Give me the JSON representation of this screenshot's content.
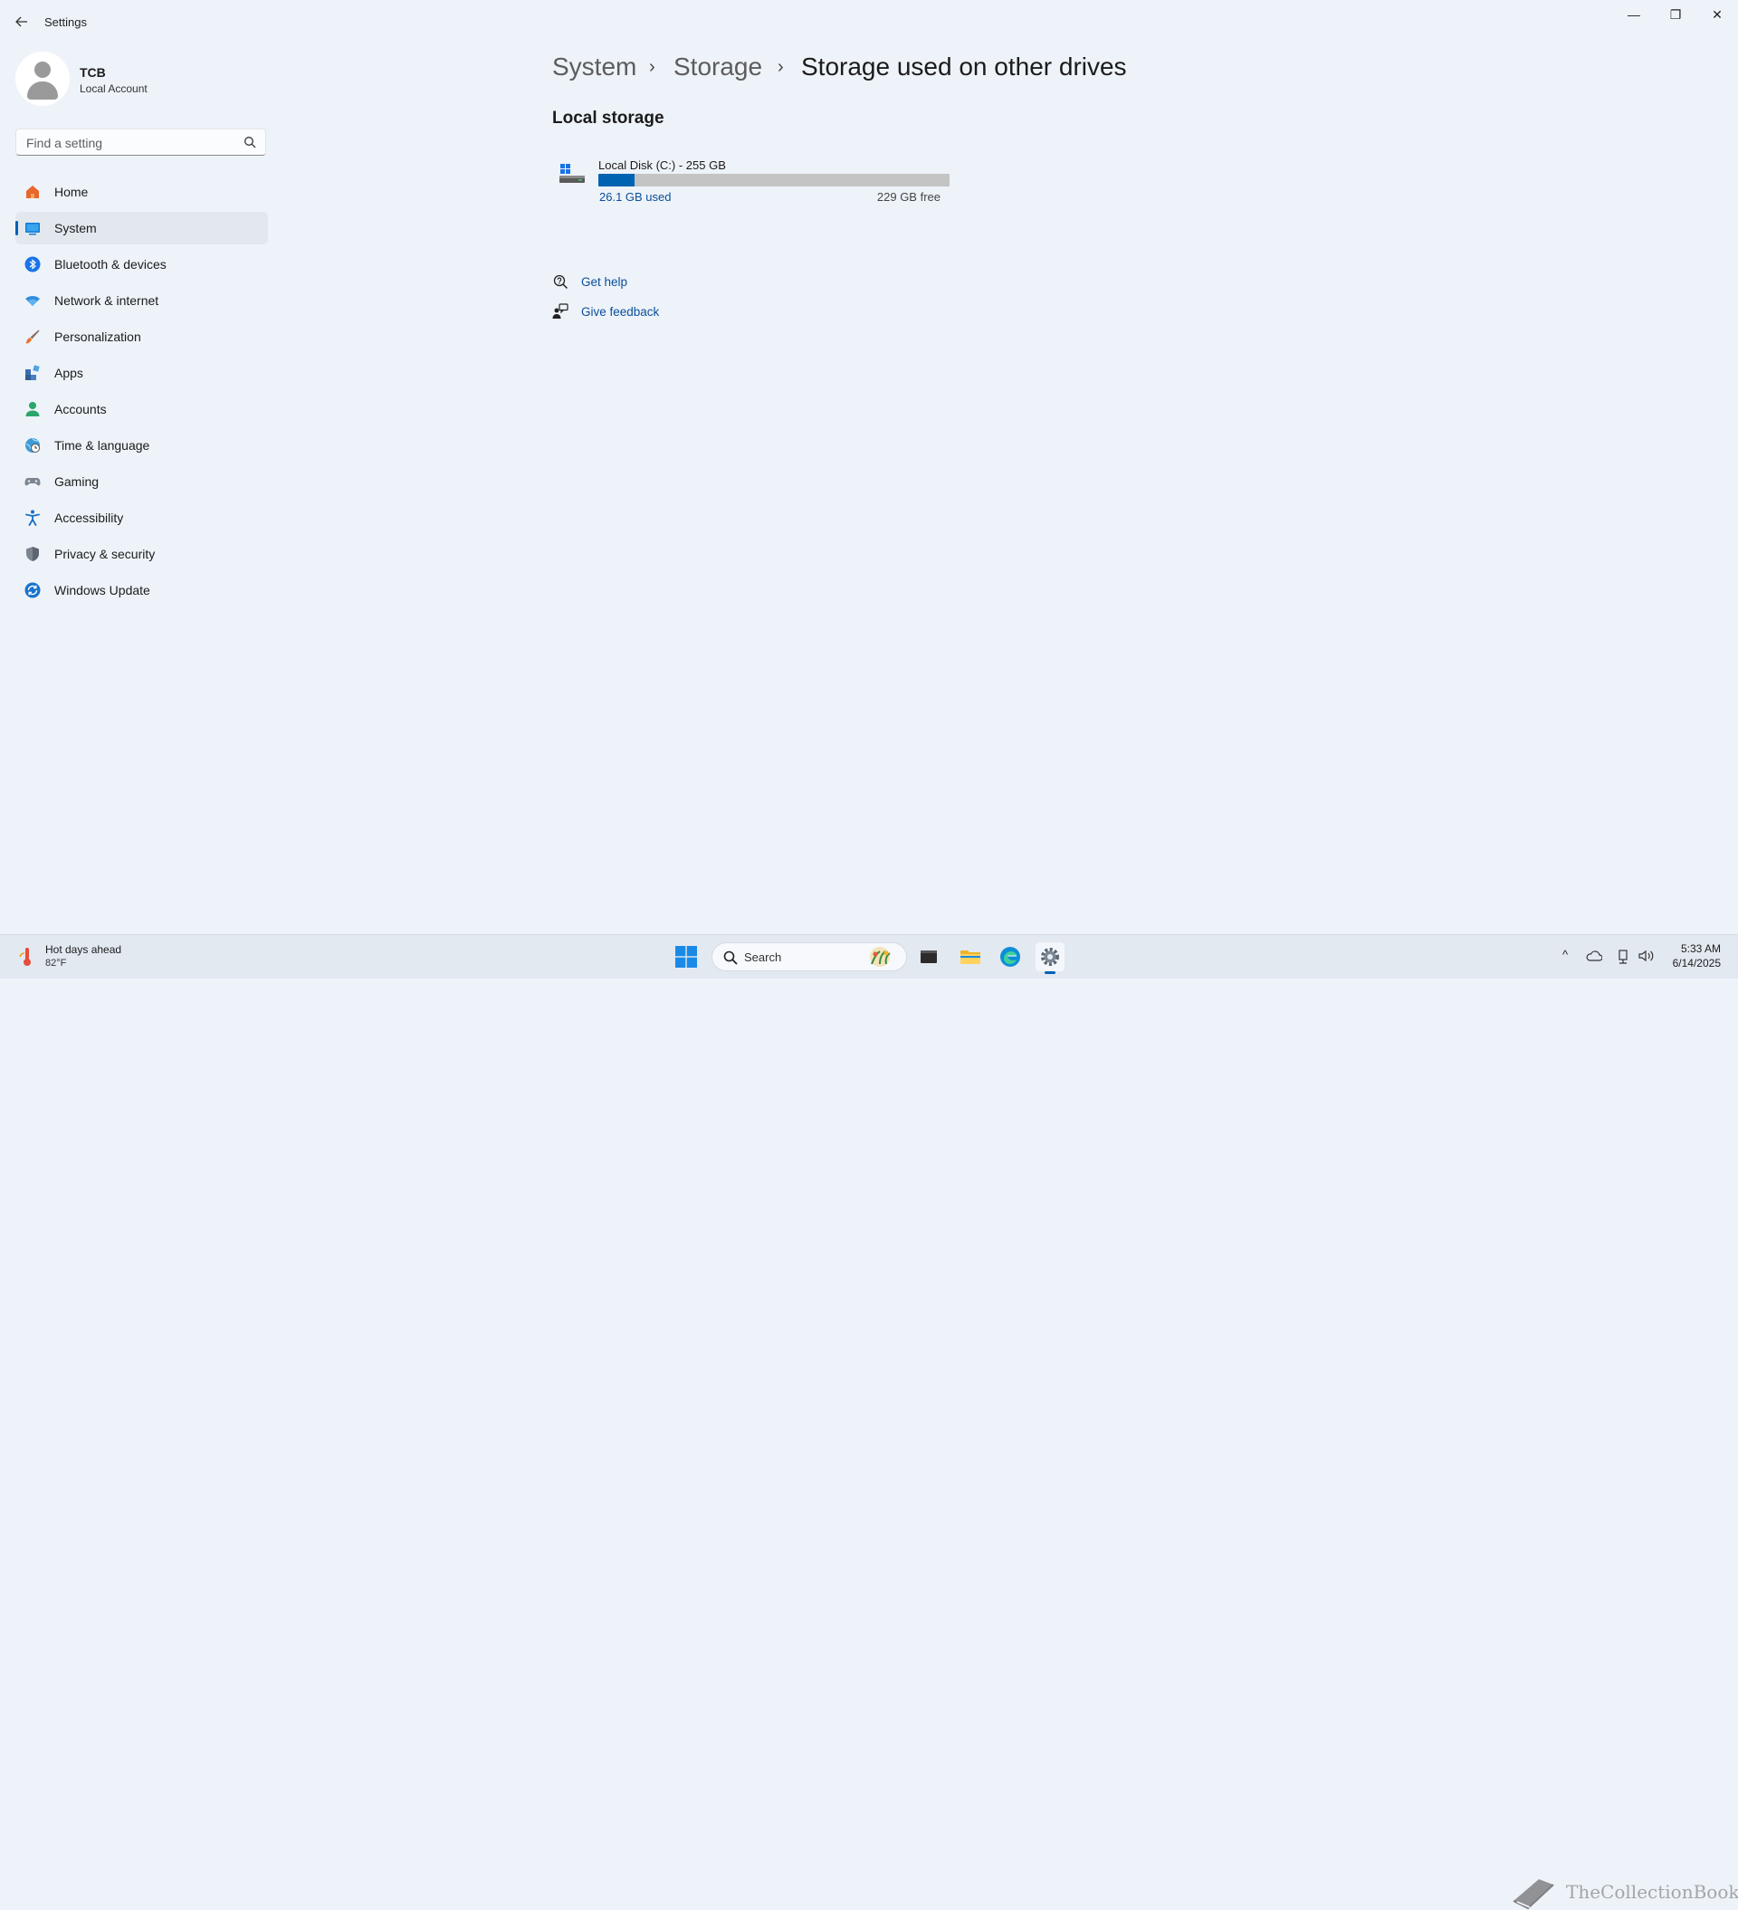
{
  "window": {
    "title": "Settings",
    "controls": {
      "minimize": "—",
      "maximize": "❐",
      "close": "✕"
    }
  },
  "profile": {
    "name": "TCB",
    "account_type": "Local Account"
  },
  "search": {
    "placeholder": "Find a setting"
  },
  "sidebar": {
    "items": [
      {
        "label": "Home",
        "icon": "home-icon"
      },
      {
        "label": "System",
        "icon": "system-icon",
        "active": true
      },
      {
        "label": "Bluetooth & devices",
        "icon": "bluetooth-icon"
      },
      {
        "label": "Network & internet",
        "icon": "wifi-icon"
      },
      {
        "label": "Personalization",
        "icon": "brush-icon"
      },
      {
        "label": "Apps",
        "icon": "apps-icon"
      },
      {
        "label": "Accounts",
        "icon": "accounts-icon"
      },
      {
        "label": "Time & language",
        "icon": "globe-clock-icon"
      },
      {
        "label": "Gaming",
        "icon": "gamepad-icon"
      },
      {
        "label": "Accessibility",
        "icon": "accessibility-icon"
      },
      {
        "label": "Privacy & security",
        "icon": "shield-icon"
      },
      {
        "label": "Windows Update",
        "icon": "update-icon"
      }
    ]
  },
  "breadcrumb": {
    "items": [
      "System",
      "Storage",
      "Storage used on other drives"
    ],
    "separator": "›"
  },
  "main": {
    "section_title": "Local storage",
    "drive": {
      "name": "Local Disk (C:) - 255 GB",
      "used": "26.1 GB used",
      "free": "229 GB free",
      "used_fraction": 0.102
    },
    "links": [
      {
        "label": "Get help",
        "icon": "help-icon"
      },
      {
        "label": "Give feedback",
        "icon": "feedback-icon"
      }
    ]
  },
  "taskbar": {
    "weather": {
      "title": "Hot days ahead",
      "temp": "82°F"
    },
    "search_label": "Search",
    "apps": [
      "terminal-icon",
      "file-explorer-icon",
      "edge-icon",
      "settings-icon"
    ],
    "tray": {
      "chevron": "^",
      "time": "5:33 AM",
      "date": "6/14/2025"
    },
    "watermark": "TheCollectionBook"
  },
  "colors": {
    "accent": "#005fb8",
    "link": "#0a4e9b",
    "background": "#eef3f9"
  }
}
